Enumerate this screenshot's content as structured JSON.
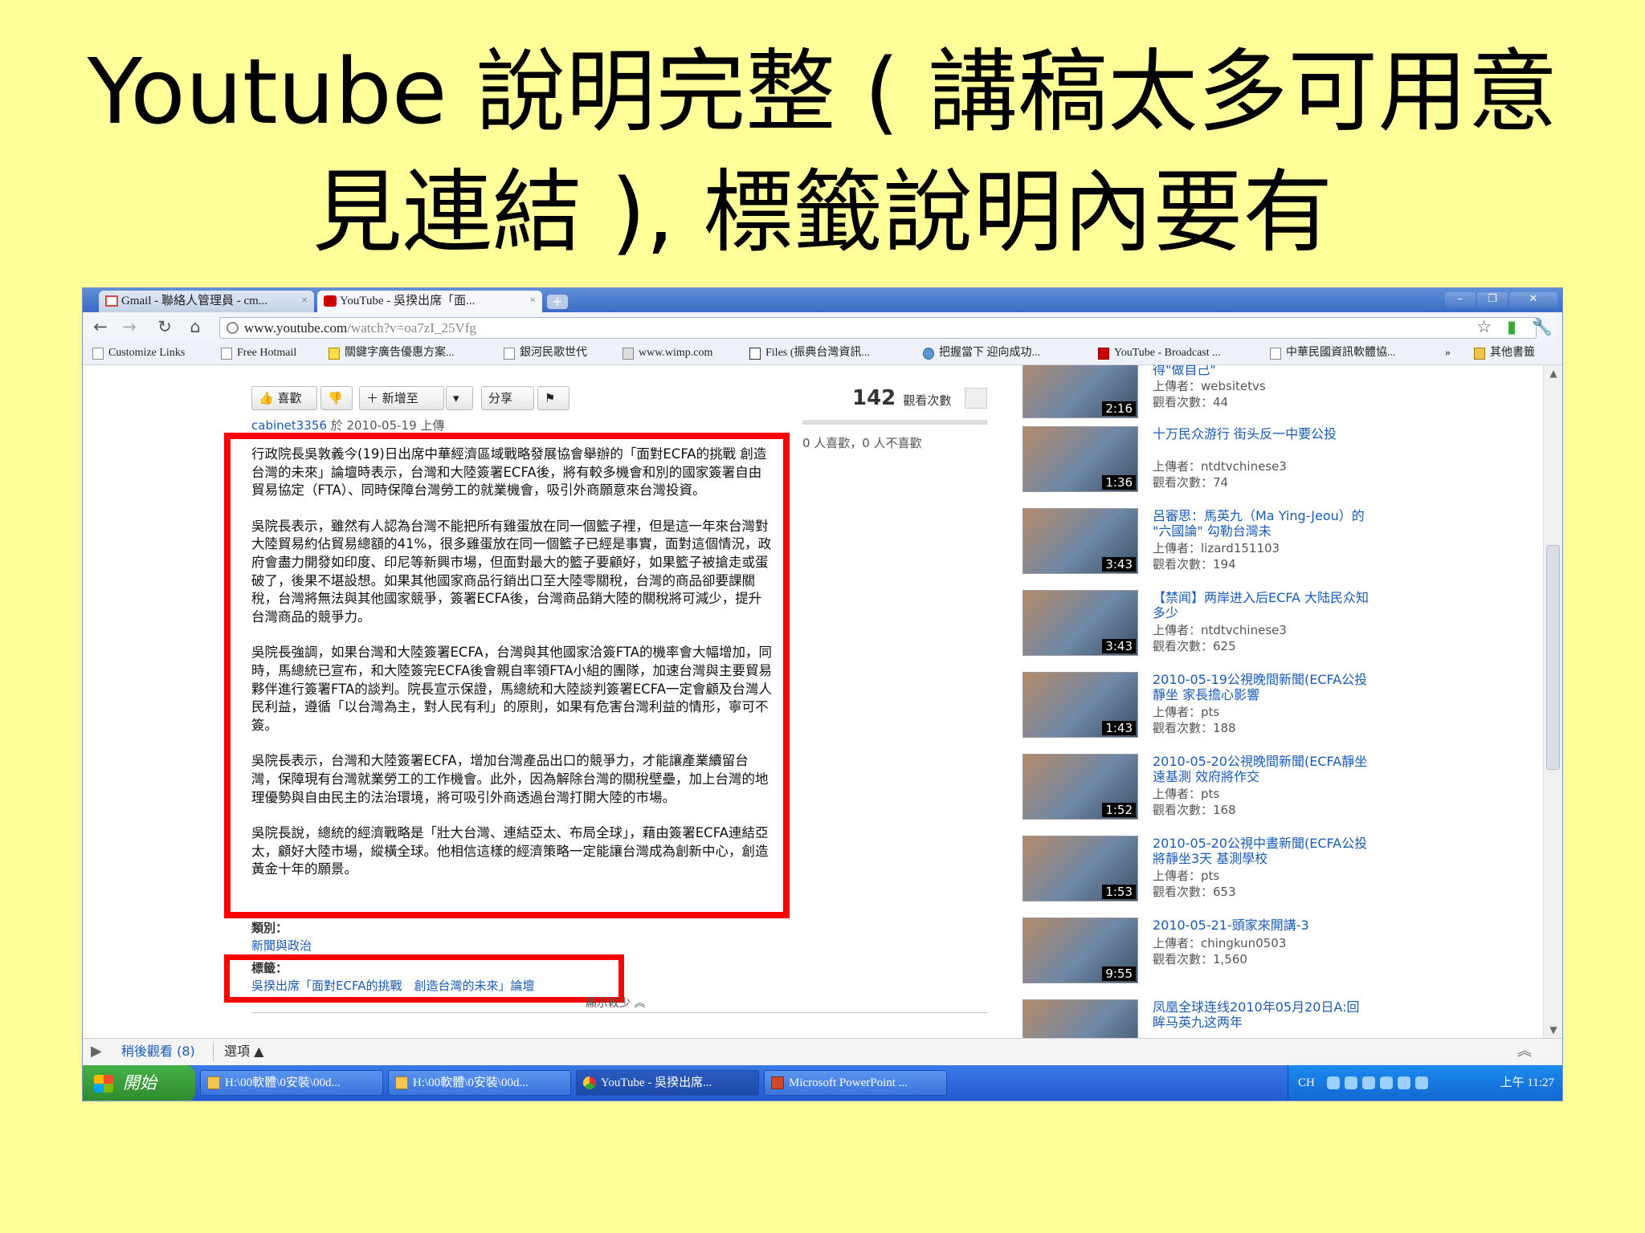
{
  "slide": {
    "title_line1": "Youtube 說明完整 ( 講稿太多可用意",
    "title_line2": "見連結 ), 標籤說明內要有"
  },
  "browser": {
    "tabs": [
      {
        "label": "Gmail - 聯絡人管理員 - cm...",
        "icon": "gmail-icon"
      },
      {
        "label": "YouTube - 吳揆出席「面...",
        "icon": "youtube-icon"
      }
    ],
    "url_domain": "www.youtube.com",
    "url_path": "/watch?v=oa7zI_25Vfg",
    "bookmarks": [
      "Customize Links",
      "Free Hotmail",
      "關鍵字廣告優惠方案...",
      "銀河民歌世代",
      "www.wimp.com",
      "Files (振典台灣資訊...",
      "把握當下 迎向成功...",
      "YouTube - Broadcast ...",
      "中華民國資訊軟體協..."
    ],
    "bookmarks_more": "»",
    "other_bookmarks": "其他書籤"
  },
  "video": {
    "like_label": "喜歡",
    "add_to_label": "新增至",
    "share_label": "分享",
    "view_count": "142",
    "views_unit": "觀看次數",
    "likes_summary": "0 人喜歡，0 人不喜歡",
    "uploader": "cabinet3356",
    "upload_date": " 於 2010-05-19 上傳",
    "description": [
      "行政院長吳敦義今(19)日出席中華經濟區域戰略發展協會舉辦的「面對ECFA的挑戰 創造台灣的未來」論壇時表示，台灣和大陸簽署ECFA後，將有較多機會和別的國家簽署自由貿易協定（FTA）、同時保障台灣勞工的就業機會，吸引外商願意來台灣投資。",
      "吳院長表示，雖然有人認為台灣不能把所有雞蛋放在同一個籃子裡，但是這一年來台灣對大陸貿易約佔貿易總額的41%，很多雞蛋放在同一個籃子已經是事實，面對這個情況，政府會盡力開發如印度、印尼等新興市場，但面對最大的籃子要顧好，如果籃子被搶走或蛋破了，後果不堪設想。如果其他國家商品行銷出口至大陸零關稅，台灣的商品卻要課關稅，台灣將無法與其他國家競爭，簽署ECFA後，台灣商品銷大陸的關稅將可減少，提升台灣商品的競爭力。",
      "吳院長強調，如果台灣和大陸簽署ECFA，台灣與其他國家洽簽FTA的機率會大幅增加，同時，馬總統已宣布，和大陸簽完ECFA後會親自率領FTA小組的團隊，加速台灣與主要貿易夥伴進行簽署FTA的談判。院長宣示保證，馬總統和大陸談判簽署ECFA一定會顧及台灣人民利益，遵循「以台灣為主，對人民有利」的原則，如果有危害台灣利益的情形，寧可不簽。",
      "吳院長表示，台灣和大陸簽署ECFA，增加台灣產品出口的競爭力，才能讓產業續留台灣，保障現有台灣就業勞工的工作機會。此外，因為解除台灣的關稅壁壘，加上台灣的地理優勢與自由民主的法治環境，將可吸引外商透過台灣打開大陸的市場。",
      "吳院長說，總統的經濟戰略是「壯大台灣、連結亞太、布局全球」，藉由簽署ECFA連結亞太，顧好大陸市場，縱橫全球。他相信這樣的經濟策略一定能讓台灣成為創新中心，創造黃金十年的願景。"
    ],
    "category_label": "類別：",
    "category": "新聞與政治",
    "tags_label": "標籤：",
    "tags": "吳揆出席「面對ECFA的挑戰　創造台灣的未來」論壇",
    "show_less": "顯示較少"
  },
  "related": [
    {
      "title": "得\"做自己\"",
      "uploader": "上傳者：websitetvs",
      "views": "觀看次數：44",
      "duration": "2:16"
    },
    {
      "title": "十万民众游行 街头反一中要公投",
      "uploader": "上傳者：ntdtvchinese3",
      "views": "觀看次數：74",
      "duration": "1:36"
    },
    {
      "title": "呂審思：馬英九（Ma Ying-Jeou）的 \"六國論\" 勾勒台灣未",
      "uploader": "上傳者：lizard151103",
      "views": "觀看次數：194",
      "duration": "3:43"
    },
    {
      "title": "【禁闻】两岸进入后ECFA 大陆民众知多少",
      "uploader": "上傳者：ntdtvchinese3",
      "views": "觀看次數：625",
      "duration": "3:43"
    },
    {
      "title": "2010-05-19公視晚間新聞(ECFA公投靜坐 家長擔心影響",
      "uploader": "上傳者：pts",
      "views": "觀看次數：188",
      "duration": "1:43"
    },
    {
      "title": "2010-05-20公視晚間新聞(ECFA靜坐遠基測 效府將作交",
      "uploader": "上傳者：pts",
      "views": "觀看次數：168",
      "duration": "1:52"
    },
    {
      "title": "2010-05-20公視中晝新聞(ECFA公投將靜坐3天 基測學校",
      "uploader": "上傳者：pts",
      "views": "觀看次數：653",
      "duration": "1:53"
    },
    {
      "title": "2010-05-21-頭家來開講-3",
      "uploader": "上傳者：chingkun0503",
      "views": "觀看次數：1,560",
      "duration": "9:55"
    },
    {
      "title": "凤凰全球连线2010年05月20日A:回眸马英九这两年",
      "uploader": "",
      "views": "",
      "duration": ""
    }
  ],
  "later_bar": {
    "watch_later": "稍後觀看 (8)",
    "options": "選項"
  },
  "taskbar": {
    "start": "開始",
    "items": [
      "H:\\00軟體\\0安裝\\00d...",
      "H:\\00軟體\\0安裝\\00d...",
      "YouTube - 吳揆出席...",
      "Microsoft PowerPoint ..."
    ],
    "lang": "CH",
    "clock": "上午 11:27"
  },
  "colors": {
    "slide_bg": "#ffff99",
    "highlight_box": "#ff0000",
    "link": "#1a5bb8",
    "taskbar": "#225ad0"
  }
}
